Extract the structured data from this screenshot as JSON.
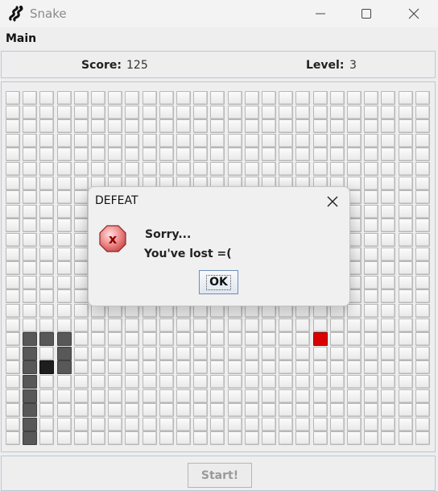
{
  "window": {
    "title": "Snake",
    "icon": "snake-icon",
    "controls": [
      "minimize-icon",
      "maximize-icon",
      "close-icon"
    ]
  },
  "menu": {
    "items": [
      "Main"
    ]
  },
  "status": {
    "score_label": "Score:",
    "score_value": "125",
    "level_label": "Level:",
    "level_value": "3"
  },
  "board": {
    "cols": 25,
    "rows": 25,
    "snake_cells": [
      [
        1,
        17
      ],
      [
        2,
        17
      ],
      [
        3,
        17
      ],
      [
        1,
        18
      ],
      [
        3,
        18
      ],
      [
        1,
        19
      ],
      [
        3,
        19
      ],
      [
        1,
        20
      ],
      [
        1,
        21
      ],
      [
        1,
        22
      ],
      [
        1,
        23
      ],
      [
        1,
        24
      ]
    ],
    "head_cell": [
      2,
      19
    ],
    "food_cell": [
      18,
      17
    ],
    "colors": {
      "empty": "#f3f3f3",
      "snake": "#585858",
      "head": "#1e1e1e",
      "food": "#d80000"
    }
  },
  "bottom": {
    "start_label": "Start!",
    "start_enabled": false
  },
  "dialog": {
    "title": "DEFEAT",
    "icon": "error-icon",
    "line1": "Sorry...",
    "line2": "You've lost =(",
    "ok_label": "OK"
  }
}
